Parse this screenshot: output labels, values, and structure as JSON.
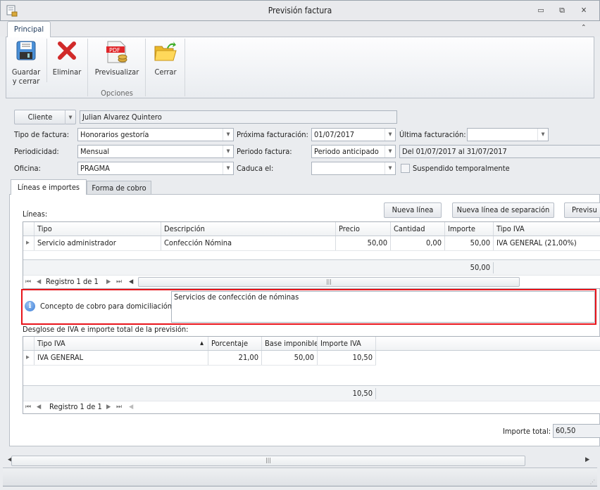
{
  "window": {
    "title": "Previsión factura",
    "minimize": "▭",
    "restore": "⧉",
    "close": "✕"
  },
  "ribbon": {
    "tab": "Principal",
    "collapse": "⌃",
    "save": "Guardar\ny cerrar",
    "save_l1": "Guardar",
    "save_l2": "y cerrar",
    "delete": "Eliminar",
    "preview": "Previsualizar",
    "close": "Cerrar",
    "group": "Opciones"
  },
  "form": {
    "cliente_button": "Cliente",
    "cliente_value": "Julian Alvarez Quintero",
    "tipo_label": "Tipo de factura:",
    "tipo_value": "Honorarios gestoría",
    "proxima_label": "Próxima facturación:",
    "proxima_value": "01/07/2017",
    "ultima_label": "Última facturación:",
    "ultima_value": "",
    "periodicidad_label": "Periodicidad:",
    "periodicidad_value": "Mensual",
    "periodo_label": "Periodo factura:",
    "periodo_value": "Periodo anticipado",
    "periodo_range": "Del 01/07/2017 al 31/07/2017",
    "oficina_label": "Oficina:",
    "oficina_value": "PRAGMA",
    "caduca_label": "Caduca el:",
    "caduca_value": "",
    "suspendido_label": "Suspendido temporalmente",
    "suspendido_checked": false
  },
  "tabs": [
    {
      "label": "Líneas e importes",
      "active": true
    },
    {
      "label": "Forma de cobro",
      "active": false
    }
  ],
  "lineas": {
    "label": "Líneas:",
    "buttons": [
      "Nueva línea",
      "Nueva línea de separación",
      "Previsu"
    ],
    "columns": [
      "Tipo",
      "Descripción",
      "Precio",
      "Cantidad",
      "Importe",
      "Tipo IVA"
    ],
    "rows": [
      [
        "Servicio administrador",
        "Confección Nómina",
        "50,00",
        "0,00",
        "50,00",
        "IVA GENERAL (21,00%)"
      ]
    ],
    "footer_total": "50,00",
    "nav": "Registro 1 de 1"
  },
  "concepto": {
    "label": "Concepto de cobro para domiciliación:",
    "value": "Servicios de confección de nóminas"
  },
  "desglose": {
    "label": "Desglose de IVA e importe total de la previsión:",
    "columns": [
      "Tipo IVA",
      "Porcentaje",
      "Base imponible",
      "Importe IVA"
    ],
    "rows": [
      [
        "IVA GENERAL",
        "21,00",
        "50,00",
        "10,50"
      ]
    ],
    "footer_total": "10,50",
    "nav": "Registro 1 de 1"
  },
  "total": {
    "label": "Importe total:",
    "value": "60,50"
  },
  "colors": {
    "highlight": "#e8141b",
    "info": "#3b7dd8"
  }
}
